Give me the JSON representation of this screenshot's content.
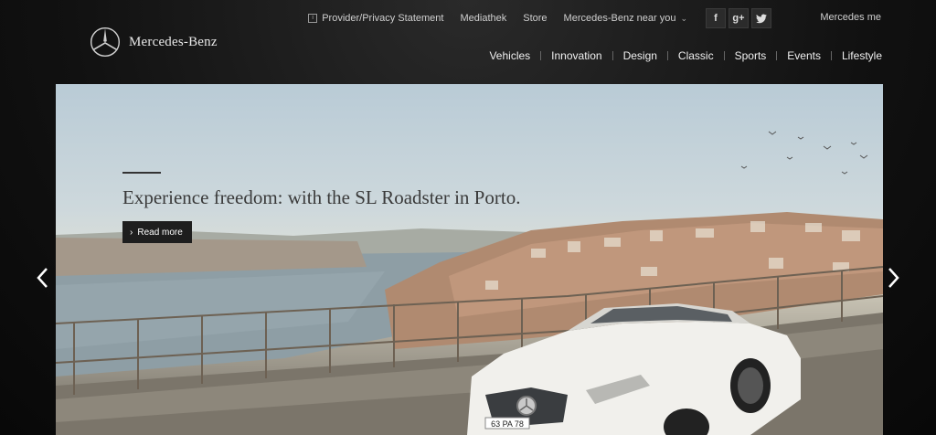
{
  "meta_nav": {
    "provider": "Provider/Privacy Statement",
    "mediathek": "Mediathek",
    "store": "Store",
    "near_you": "Mercedes-Benz near you",
    "mercedes_me": "Mercedes me"
  },
  "social": {
    "facebook": "f",
    "googleplus": "g+",
    "twitter": "twitter-icon"
  },
  "brand": {
    "name": "Mercedes-Benz",
    "icon": "mercedes-star-icon"
  },
  "main_nav": [
    "Vehicles",
    "Innovation",
    "Design",
    "Classic",
    "Sports",
    "Events",
    "Lifestyle"
  ],
  "hero": {
    "title": "Experience freedom: with the SL Roadster in Porto.",
    "cta": "Read more",
    "plate": "63 PA 78"
  },
  "carousel": {
    "prev_icon": "chevron-left-icon",
    "next_icon": "chevron-right-icon"
  }
}
